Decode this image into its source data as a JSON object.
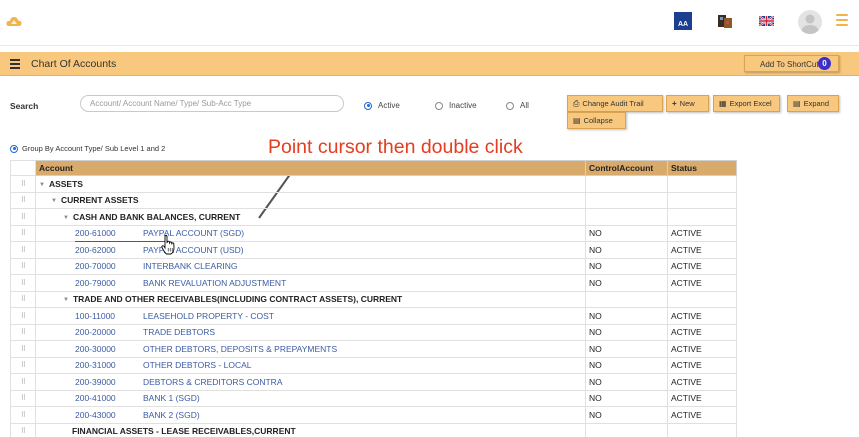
{
  "topbar": {
    "logo_icon": "cloud-logo-icon",
    "font_size_icon_label": "AA",
    "accent": "#f0b44c"
  },
  "header": {
    "title": "Chart Of Accounts",
    "shortcut_label": "Add To ShortCut",
    "shortcut_badge": "0",
    "band_color": "#f8c87e"
  },
  "search": {
    "label": "Search",
    "placeholder": "Account/ Account Name/ Type/ Sub-Acc Type",
    "value": "",
    "filters": [
      {
        "label": "Active",
        "selected": true
      },
      {
        "label": "Inactive",
        "selected": false
      },
      {
        "label": "All",
        "selected": false
      }
    ]
  },
  "actions": {
    "change_audit_trail": "Change Audit Trail",
    "new": "New",
    "export_excel": "Export Excel",
    "expand": "Expand",
    "collapse": "Collapse"
  },
  "group_by": {
    "label": "Group By Account Type/ Sub Level 1 and 2",
    "selected": true
  },
  "annotation": {
    "text": "Point cursor then double click",
    "color": "#e43d1f"
  },
  "table": {
    "columns": [
      "Account",
      "ControlAccount",
      "Status"
    ],
    "rows": [
      {
        "kind": "group",
        "level": 0,
        "label": "ASSETS",
        "caret": true
      },
      {
        "kind": "group",
        "level": 1,
        "label": "CURRENT ASSETS",
        "caret": true
      },
      {
        "kind": "group",
        "level": 2,
        "label": "CASH AND BANK BALANCES, CURRENT",
        "caret": true
      },
      {
        "kind": "account",
        "code": "200-61000",
        "name": "PAYPAL ACCOUNT (SGD)",
        "control": "NO",
        "status": "ACTIVE"
      },
      {
        "kind": "account",
        "code": "200-62000",
        "name": "PAYPAL ACCOUNT (USD)",
        "control": "NO",
        "status": "ACTIVE"
      },
      {
        "kind": "account",
        "code": "200-70000",
        "name": "INTERBANK CLEARING",
        "control": "NO",
        "status": "ACTIVE"
      },
      {
        "kind": "account",
        "code": "200-79000",
        "name": "BANK REVALUATION ADJUSTMENT",
        "control": "NO",
        "status": "ACTIVE"
      },
      {
        "kind": "group",
        "level": 2,
        "label": "TRADE AND OTHER RECEIVABLES(INCLUDING CONTRACT ASSETS), CURRENT",
        "caret": true
      },
      {
        "kind": "account",
        "code": "100-11000",
        "name": "LEASEHOLD PROPERTY - COST",
        "control": "NO",
        "status": "ACTIVE"
      },
      {
        "kind": "account",
        "code": "200-20000",
        "name": "TRADE DEBTORS",
        "control": "NO",
        "status": "ACTIVE"
      },
      {
        "kind": "account",
        "code": "200-30000",
        "name": "OTHER DEBTORS, DEPOSITS & PREPAYMENTS",
        "control": "NO",
        "status": "ACTIVE"
      },
      {
        "kind": "account",
        "code": "200-31000",
        "name": "OTHER DEBTORS - LOCAL",
        "control": "NO",
        "status": "ACTIVE"
      },
      {
        "kind": "account",
        "code": "200-39000",
        "name": "DEBTORS & CREDITORS CONTRA",
        "control": "NO",
        "status": "ACTIVE"
      },
      {
        "kind": "account",
        "code": "200-41000",
        "name": "BANK 1 (SGD)",
        "control": "NO",
        "status": "ACTIVE"
      },
      {
        "kind": "account",
        "code": "200-43000",
        "name": "BANK 2 (SGD)",
        "control": "NO",
        "status": "ACTIVE"
      },
      {
        "kind": "group",
        "level": 2,
        "label": "FINANCIAL ASSETS - LEASE RECEIVABLES,CURRENT",
        "caret": false
      }
    ]
  }
}
